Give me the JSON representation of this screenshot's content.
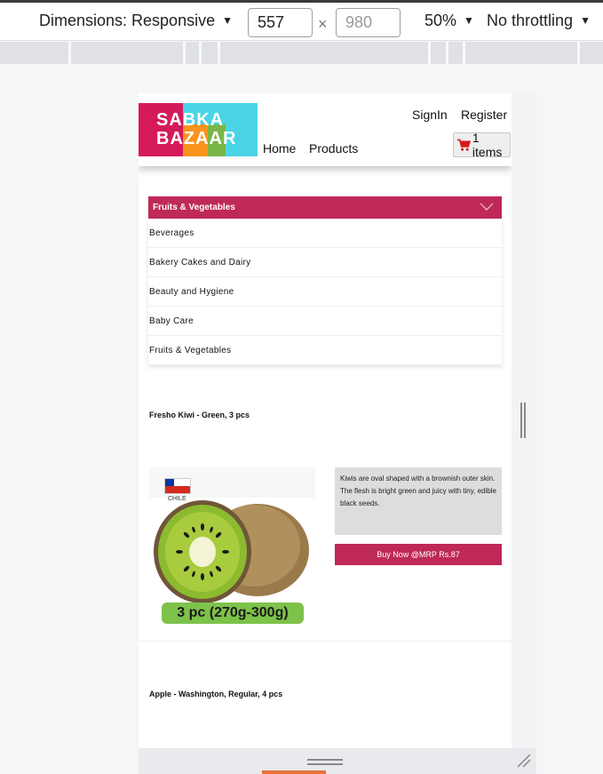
{
  "devtools": {
    "dimensions_label": "Dimensions: Responsive",
    "width_value": "557",
    "times": "×",
    "height_placeholder": "980",
    "zoom": "50%",
    "throttling": "No throttling"
  },
  "header": {
    "logo_line1": "SABKA",
    "logo_line2": "BAZAAR",
    "nav": {
      "home": "Home",
      "products": "Products"
    },
    "auth": {
      "signin": "SignIn",
      "register": "Register"
    },
    "cart": {
      "label": "1 items",
      "icon": "cart-icon"
    }
  },
  "category": {
    "selected": "Fruits & Vegetables",
    "items": [
      "Beverages",
      "Bakery Cakes and Dairy",
      "Beauty and Hygiene",
      "Baby Care",
      "Fruits & Vegetables"
    ]
  },
  "products": [
    {
      "name": "Fresho Kiwi - Green, 3 pcs",
      "country": "CHILE",
      "pack": "3 pc (270g-300g)",
      "description": "Kiwis are oval shaped with a brownish outer skin. The flesh is bright green and juicy with tiny, edible black seeds.",
      "buy_label": "Buy Now @MRP Rs.87"
    },
    {
      "name": "Apple - Washington, Regular, 4 pcs"
    }
  ],
  "colors": {
    "brand": "#bf2957",
    "cart_icon": "#d51a1a"
  }
}
